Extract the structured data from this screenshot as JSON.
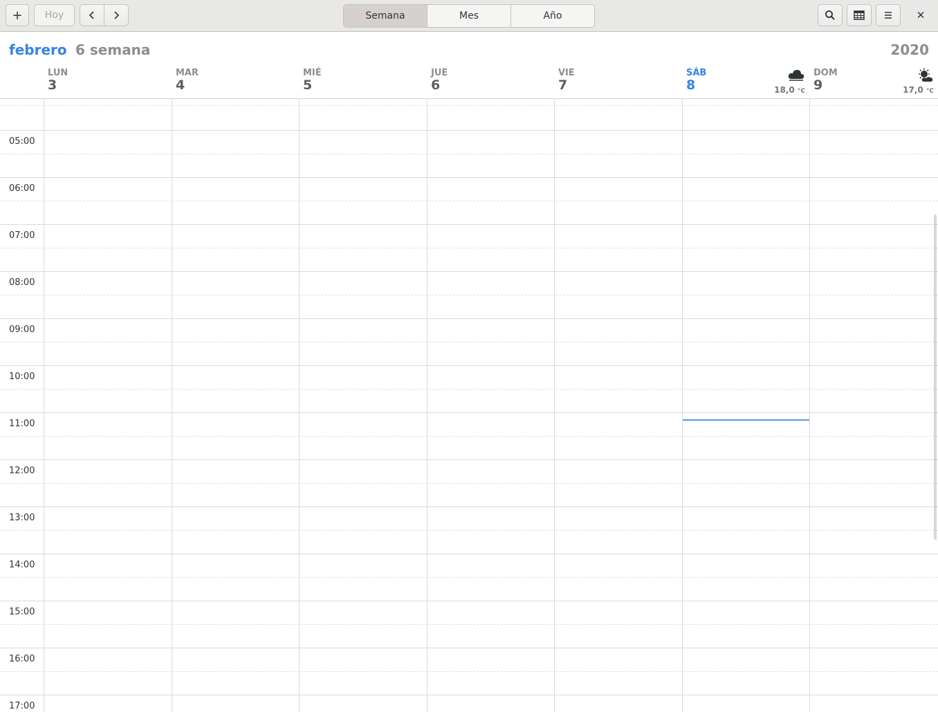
{
  "header": {
    "new_event_label": "+",
    "today_label": "Hoy",
    "views": [
      "Semana",
      "Mes",
      "Año"
    ],
    "active_view": "Semana",
    "close_label": "✕"
  },
  "title": {
    "month": "febrero",
    "week": "6 semana",
    "year": "2020"
  },
  "days": [
    {
      "name": "LUN",
      "date": "3"
    },
    {
      "name": "MAR",
      "date": "4"
    },
    {
      "name": "MIÉ",
      "date": "5"
    },
    {
      "name": "JUE",
      "date": "6"
    },
    {
      "name": "VIE",
      "date": "7"
    },
    {
      "name": "SÁB",
      "date": "8",
      "today": true,
      "weather": {
        "temp": "18,0",
        "unit": "°C",
        "icon": "cloudy-icon"
      }
    },
    {
      "name": "DOM",
      "date": "9",
      "weather": {
        "temp": "17,0",
        "unit": "°C",
        "icon": "partly-sunny-icon"
      }
    }
  ],
  "hours": [
    "05:00",
    "06:00",
    "07:00",
    "08:00",
    "09:00",
    "10:00",
    "11:00",
    "12:00",
    "13:00",
    "14:00",
    "15:00",
    "16:00",
    "17:00"
  ],
  "colors": {
    "accent": "#3584e4",
    "grid": "#dcdad7",
    "muted": "#8b8e8f"
  }
}
